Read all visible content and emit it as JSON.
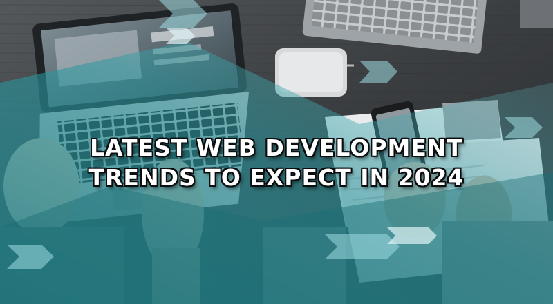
{
  "banner": {
    "title_line_1": "LATEST WEB DEVELOPMENT",
    "title_line_2": "TRENDS TO EXPECT IN 2024"
  },
  "scene": {
    "description_icons": [
      "laptop-icon",
      "smartphone-icon",
      "hands-icon",
      "papers-icon",
      "wallet-icon"
    ],
    "colors": {
      "desk": "#3a3d40",
      "teal_overlay": "#2a8f95",
      "light_teal_overlay": "#8fd3d8",
      "headline_text": "#ffffff",
      "headline_outline": "#0b0d0f"
    }
  }
}
